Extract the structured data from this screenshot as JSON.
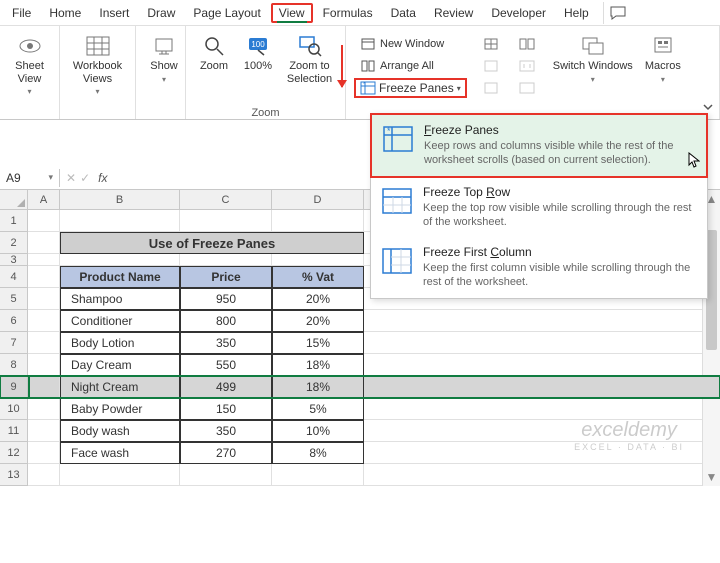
{
  "menu": {
    "items": [
      "File",
      "Home",
      "Insert",
      "Draw",
      "Page Layout",
      "View",
      "Formulas",
      "Data",
      "Review",
      "Developer",
      "Help"
    ],
    "active_index": 5
  },
  "ribbon": {
    "sheet_view": "Sheet View",
    "workbook_views": "Workbook Views",
    "show": "Show",
    "zoom": "Zoom",
    "zoom100": "100%",
    "zoom_to_selection": "Zoom to Selection",
    "zoom_group": "Zoom",
    "new_window": "New Window",
    "arrange_all": "Arrange All",
    "freeze_panes": "Freeze Panes",
    "switch_windows": "Switch Windows",
    "macros": "Macros"
  },
  "dropdown": {
    "items": [
      {
        "title": "Freeze Panes",
        "desc": "Keep rows and columns visible while the rest of the worksheet scrolls (based on current selection)."
      },
      {
        "title": "Freeze Top Row",
        "desc": "Keep the top row visible while scrolling through the rest of the worksheet."
      },
      {
        "title": "Freeze First Column",
        "desc": "Keep the first column visible while scrolling through the rest of the worksheet."
      }
    ]
  },
  "formula_bar": {
    "name_box": "A9",
    "fx": "fx",
    "value": ""
  },
  "grid": {
    "columns": [
      "A",
      "B",
      "C",
      "D"
    ],
    "title": "Use of Freeze Panes",
    "headers": [
      "Product Name",
      "Price",
      "% Vat"
    ],
    "rows": [
      {
        "n": "Shampoo",
        "p": "950",
        "v": "20%"
      },
      {
        "n": "Conditioner",
        "p": "800",
        "v": "20%"
      },
      {
        "n": "Body Lotion",
        "p": "350",
        "v": "15%"
      },
      {
        "n": "Day Cream",
        "p": "550",
        "v": "18%"
      },
      {
        "n": "Night Cream",
        "p": "499",
        "v": "18%"
      },
      {
        "n": "Baby Powder",
        "p": "150",
        "v": "5%"
      },
      {
        "n": "Body wash",
        "p": "350",
        "v": "10%"
      },
      {
        "n": "Face wash",
        "p": "270",
        "v": "8%"
      }
    ],
    "row_labels": [
      "1",
      "2",
      "3",
      "4",
      "5",
      "6",
      "7",
      "8",
      "9",
      "10",
      "11",
      "12",
      "13"
    ],
    "selected_row": 9
  },
  "watermark": {
    "t1": "exceldemy",
    "t2": "EXCEL · DATA · BI"
  }
}
